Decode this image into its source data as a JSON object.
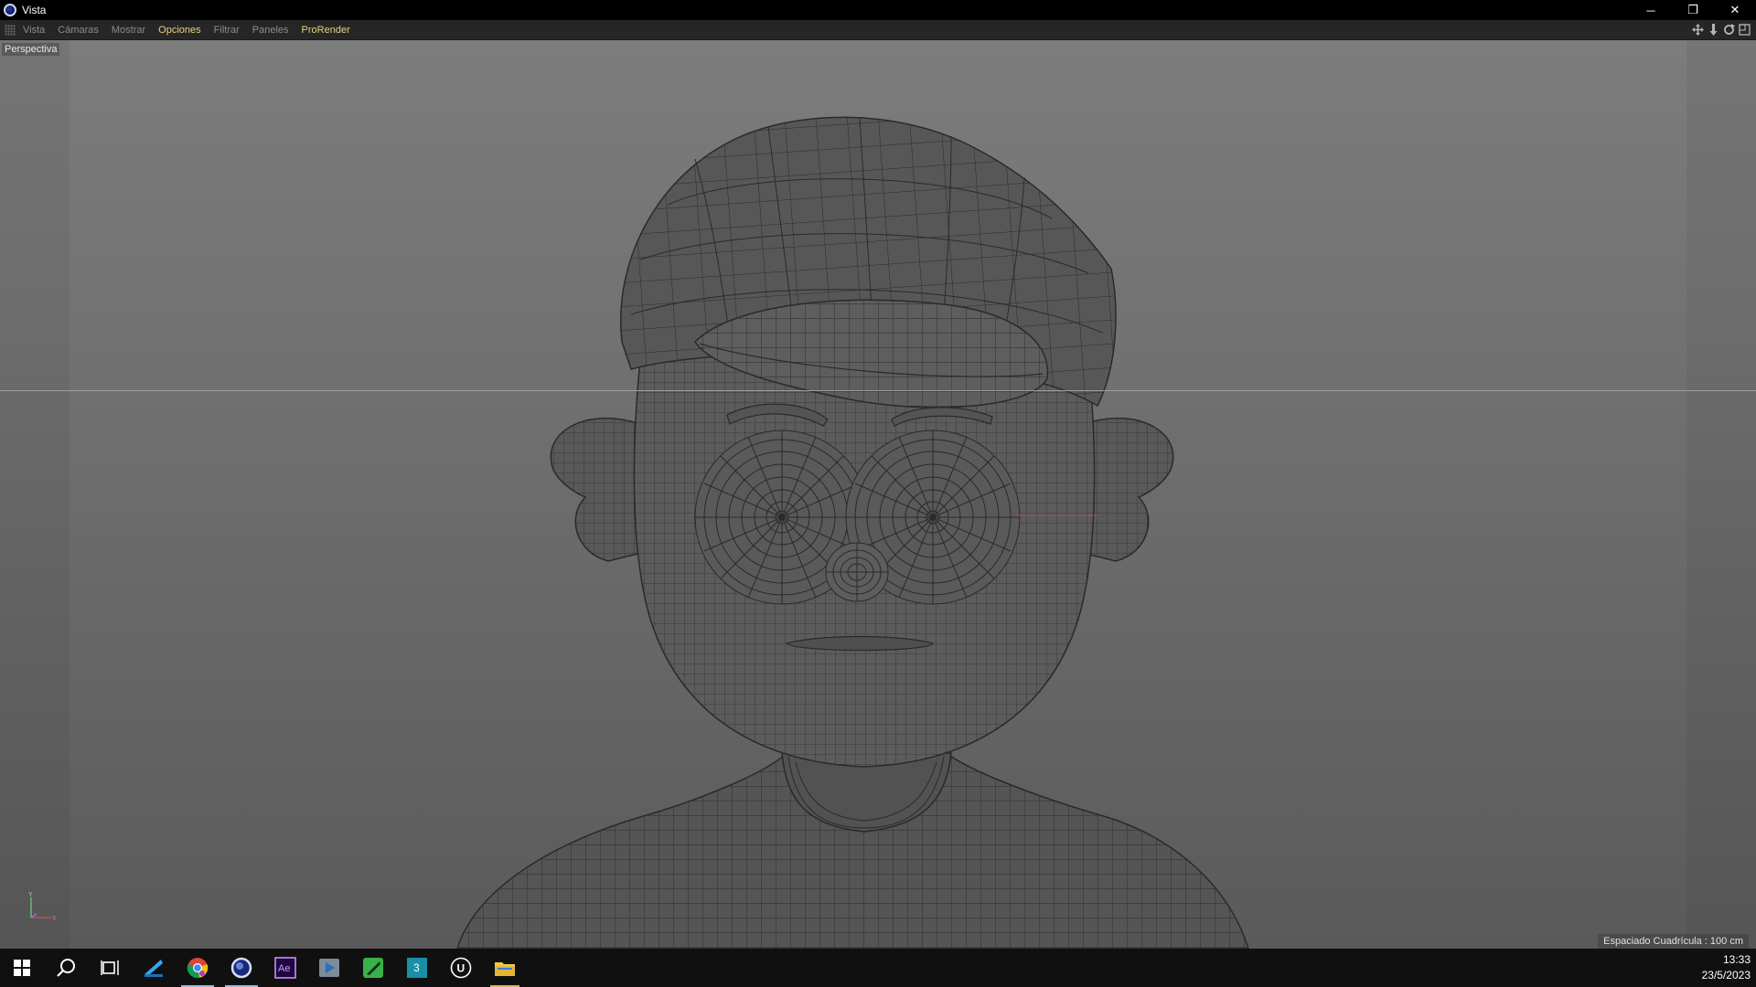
{
  "window": {
    "title": "Vista",
    "controls": {
      "minimize": "─",
      "restore": "❐",
      "close": "✕"
    }
  },
  "menu": {
    "items": [
      {
        "label": "Vista",
        "highlight": false
      },
      {
        "label": "Cámaras",
        "highlight": false
      },
      {
        "label": "Mostrar",
        "highlight": false
      },
      {
        "label": "Opciones",
        "highlight": true
      },
      {
        "label": "Filtrar",
        "highlight": false
      },
      {
        "label": "Paneles",
        "highlight": false
      },
      {
        "label": "ProRender",
        "highlight": true
      }
    ],
    "nav_tools": [
      "move-view-icon",
      "zoom-view-icon",
      "rotate-view-icon",
      "maximize-view-icon"
    ]
  },
  "viewport": {
    "label": "Perspectiva",
    "grid_spacing": "Espaciado Cuadrícula : 100 cm",
    "axes": {
      "y": "Y",
      "x": "X"
    }
  },
  "taskbar": {
    "items": [
      {
        "name": "start-icon"
      },
      {
        "name": "search-icon"
      },
      {
        "name": "task-view-icon"
      },
      {
        "name": "app-blue-icon"
      },
      {
        "name": "chrome-icon",
        "state": "active"
      },
      {
        "name": "cinema4d-icon",
        "state": "active"
      },
      {
        "name": "after-effects-icon",
        "label": "Ae"
      },
      {
        "name": "media-player-icon"
      },
      {
        "name": "green-app-icon"
      },
      {
        "name": "3ds-max-icon",
        "label": "3"
      },
      {
        "name": "unreal-engine-icon",
        "label": "U"
      },
      {
        "name": "file-explorer-icon",
        "state": "running"
      }
    ],
    "clock": {
      "time": "13:33",
      "date": "23/5/2023"
    }
  },
  "colors": {
    "menu_highlight": "#e7d27b",
    "menu_text": "#8c8c8c",
    "viewport_top": "#7c7c7c",
    "viewport_bottom": "#5a5a5a",
    "mesh_fill": "#5b5b5b",
    "mesh_wire": "#2b2b2b"
  }
}
